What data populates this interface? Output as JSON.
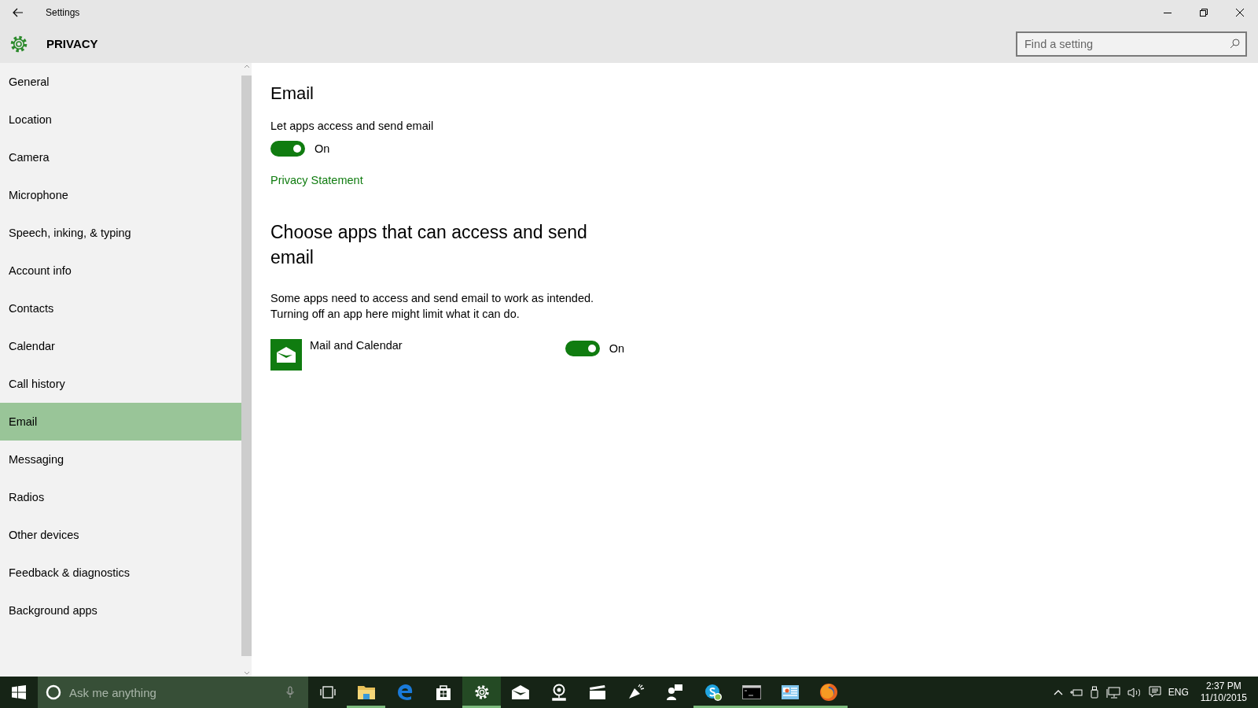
{
  "window": {
    "title": "Settings"
  },
  "header": {
    "title": "PRIVACY"
  },
  "search": {
    "placeholder": "Find a setting"
  },
  "sidebar": {
    "items": [
      {
        "label": "General",
        "selected": false
      },
      {
        "label": "Location",
        "selected": false
      },
      {
        "label": "Camera",
        "selected": false
      },
      {
        "label": "Microphone",
        "selected": false
      },
      {
        "label": "Speech, inking, & typing",
        "selected": false
      },
      {
        "label": "Account info",
        "selected": false
      },
      {
        "label": "Contacts",
        "selected": false
      },
      {
        "label": "Calendar",
        "selected": false
      },
      {
        "label": "Call history",
        "selected": false
      },
      {
        "label": "Email",
        "selected": true
      },
      {
        "label": "Messaging",
        "selected": false
      },
      {
        "label": "Radios",
        "selected": false
      },
      {
        "label": "Other devices",
        "selected": false
      },
      {
        "label": "Feedback & diagnostics",
        "selected": false
      },
      {
        "label": "Background apps",
        "selected": false
      }
    ]
  },
  "content": {
    "title": "Email",
    "setting_label": "Let apps access and send email",
    "access_toggle": {
      "on": true,
      "label": "On"
    },
    "link": "Privacy Statement",
    "section_title": "Choose apps that can access and send email",
    "description_lines": [
      "Some apps need to access and send email to work as intended.",
      "Turning off an app here might limit what it can do."
    ],
    "apps": [
      {
        "name": "Mail and Calendar",
        "on": true,
        "label": "On"
      }
    ]
  },
  "taskbar": {
    "search_placeholder": "Ask me anything",
    "apps": [
      {
        "kind": "taskview",
        "running": false,
        "selected": false
      },
      {
        "kind": "explorer",
        "running": true,
        "selected": false
      },
      {
        "kind": "edge",
        "running": false,
        "selected": false
      },
      {
        "kind": "store",
        "running": false,
        "selected": false
      },
      {
        "kind": "settings",
        "running": true,
        "selected": true
      },
      {
        "kind": "mail",
        "running": false,
        "selected": false
      },
      {
        "kind": "maps",
        "running": false,
        "selected": false
      },
      {
        "kind": "movies",
        "running": false,
        "selected": false
      },
      {
        "kind": "getstarted",
        "running": false,
        "selected": false
      },
      {
        "kind": "people",
        "running": false,
        "selected": false
      },
      {
        "kind": "skype",
        "running": true,
        "selected": false
      },
      {
        "kind": "cmd",
        "running": true,
        "selected": false
      },
      {
        "kind": "control",
        "running": true,
        "selected": false
      },
      {
        "kind": "firefox",
        "running": true,
        "selected": false
      }
    ],
    "language": "ENG",
    "time": "2:37 PM",
    "date": "11/10/2015"
  }
}
